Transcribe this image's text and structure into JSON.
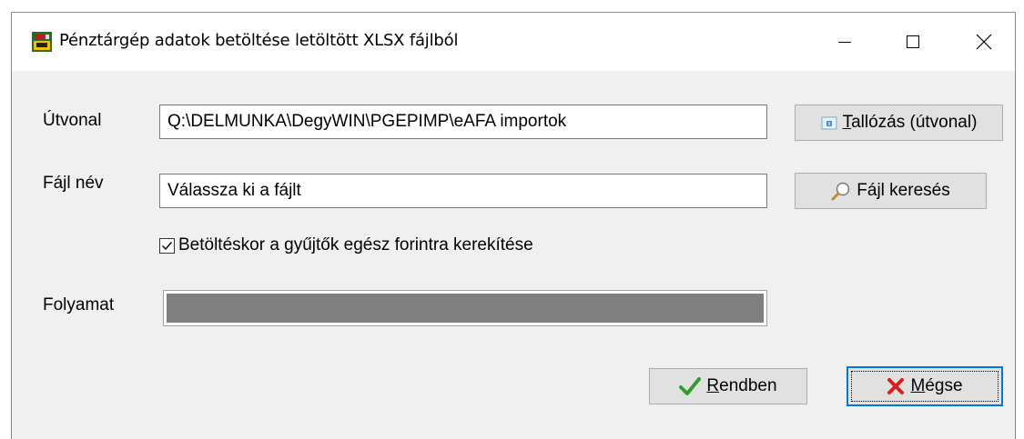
{
  "window": {
    "title": "Pénztárgép adatok betöltése letöltött XLSX fájlból",
    "icon": "cash-register-app-icon"
  },
  "form": {
    "path_label": "Útvonal",
    "path_value": "Q:\\DELMUNKA\\DegyWIN\\PGEPIMP\\eAFA importok",
    "browse_button": {
      "accel": "T",
      "rest": "allózás (útvonal)"
    },
    "file_label": "Fájl név",
    "file_value": "Válassza ki a fájlt",
    "search_button": "Fájl keresés",
    "checkbox_label": "Betöltéskor a gyűjtők egész forintra kerekítése",
    "checkbox_checked": true,
    "progress_label": "Folyamat",
    "progress_value": 1.0
  },
  "buttons": {
    "ok": {
      "accel": "R",
      "rest": "endben"
    },
    "cancel": {
      "accel": "M",
      "rest": "égse"
    }
  },
  "colors": {
    "ok_icon": "#2e9e2e",
    "cancel_icon": "#d81e1e",
    "focus_border": "#0078d7",
    "progress_fill": "#808080"
  }
}
